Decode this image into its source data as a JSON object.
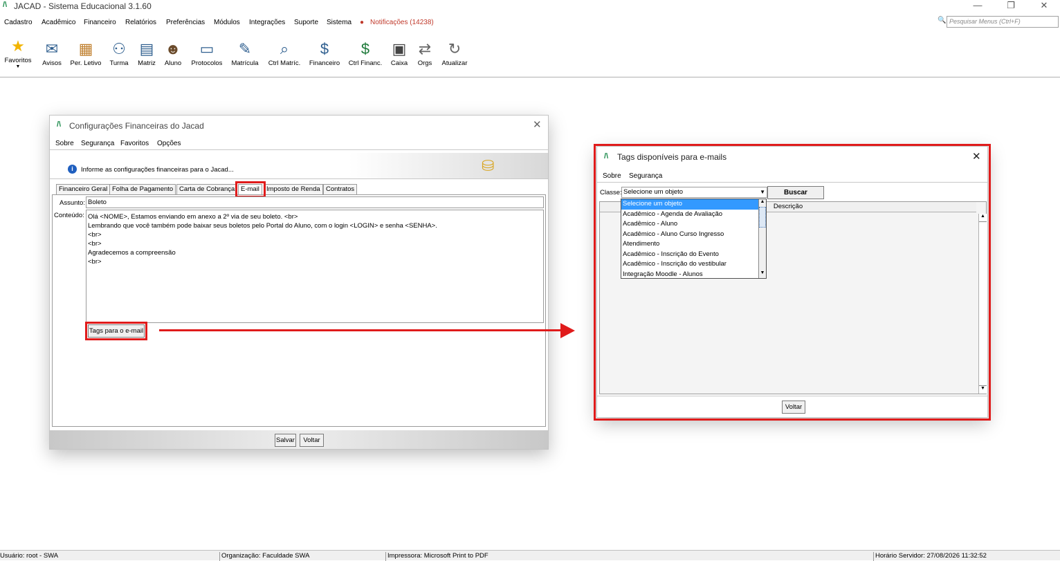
{
  "app": {
    "title": "JACAD - Sistema Educacional 3.1.60",
    "logo": "/\\",
    "min": "—",
    "restore": "❐",
    "close": "✕"
  },
  "menu": {
    "items": [
      "Cadastro",
      "Acadêmico",
      "Financeiro",
      "Relatórios",
      "Preferências",
      "Módulos",
      "Integrações",
      "Suporte",
      "Sistema"
    ],
    "notifications": "Notificações (14238)",
    "search_placeholder": "Pesquisar Menus (Ctrl+F)"
  },
  "toolbar": {
    "items": [
      {
        "label": "Favoritos",
        "icon": "star-icon"
      },
      {
        "label": "Avisos",
        "icon": "mail-icon"
      },
      {
        "label": "Per. Letivo",
        "icon": "calendar-icon"
      },
      {
        "label": "Turma",
        "icon": "group-icon"
      },
      {
        "label": "Matriz",
        "icon": "matrix-icon"
      },
      {
        "label": "Aluno",
        "icon": "student-icon"
      },
      {
        "label": "Protocolos",
        "icon": "protocol-icon"
      },
      {
        "label": "Matrícula",
        "icon": "enroll-icon"
      },
      {
        "label": "Ctrl Matríc.",
        "icon": "enroll-control-icon"
      },
      {
        "label": "Financeiro",
        "icon": "finance-icon"
      },
      {
        "label": "Ctrl Financ.",
        "icon": "finance-control-icon"
      },
      {
        "label": "Caixa",
        "icon": "cash-register-icon"
      },
      {
        "label": "Orgs",
        "icon": "swap-icon"
      },
      {
        "label": "Atualizar",
        "icon": "refresh-icon"
      }
    ]
  },
  "config_window": {
    "title": "Configurações Financeiras do Jacad",
    "menu": [
      "Sobre",
      "Segurança",
      "Favoritos",
      "Opções"
    ],
    "info": "Informe as configurações financeiras para o Jacad...",
    "tabs": [
      "Financeiro Geral",
      "Folha de Pagamento",
      "Carta de Cobrança",
      "E-mail",
      "Imposto de Renda",
      "Contratos"
    ],
    "active_tab": "E-mail",
    "subject_label": "Assunto:",
    "subject_value": "Boleto",
    "content_label": "Conteúdo:",
    "content_lines": [
      "Olá <NOME>, Estamos enviando em anexo a 2º via de seu boleto. <br>",
      "Lembrando que você também pode baixar seus boletos pelo Portal do Aluno, com o login <LOGIN> e senha <SENHA>.",
      "<br>",
      "<br>",
      "Agradecemos a compreensão",
      "<br>"
    ],
    "tags_button": "Tags para o e-mail",
    "save_button": "Salvar",
    "back_button": "Voltar"
  },
  "tags_window": {
    "title": "Tags disponíveis para e-mails",
    "menu": [
      "Sobre",
      "Segurança"
    ],
    "class_label": "Classe:",
    "class_value": "Selecione um objeto",
    "search_button": "Buscar",
    "column_header": "Descrição",
    "options": [
      "Selecione um objeto",
      "Acadêmico - Agenda de Avaliação",
      "Acadêmico - Aluno",
      "Acadêmico - Aluno Curso Ingresso",
      "Atendimento",
      "Acadêmico - Inscrição do Evento",
      "Acadêmico - Inscrição do vestibular",
      "Integração Moodle - Alunos"
    ],
    "back_button": "Voltar"
  },
  "status": {
    "user": "Usuário: root - SWA",
    "org": "Organização: Faculdade SWA",
    "printer": "Impressora: Microsoft Print to PDF",
    "server_time": "Horário Servidor: 27/08/2026 11:32:52"
  },
  "colors": {
    "highlight": "#e01b1b",
    "selection": "#3399ff"
  }
}
